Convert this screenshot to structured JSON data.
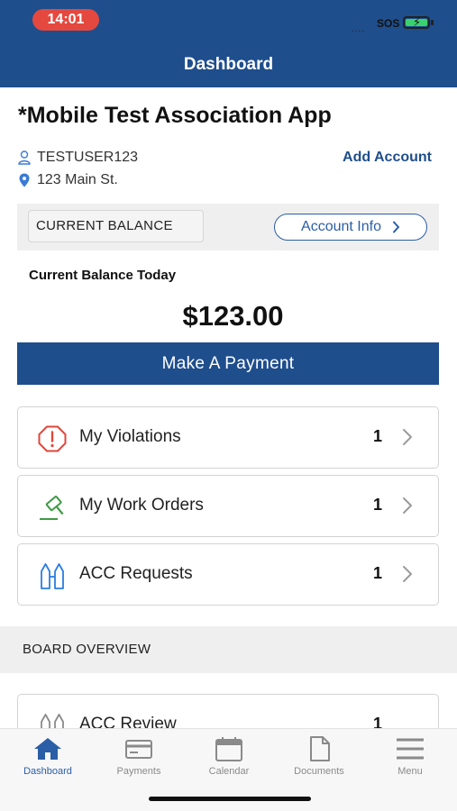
{
  "status_bar": {
    "time": "14:01",
    "signal": "....",
    "sos": "SOS"
  },
  "header": {
    "title": "Dashboard"
  },
  "app": {
    "title": "*Mobile Test Association App",
    "username": "TESTUSER123",
    "address": "123 Main St.",
    "add_account_label": "Add Account"
  },
  "balance": {
    "tab_label": "CURRENT BALANCE",
    "account_info_label": "Account Info",
    "today_label": "Current Balance Today",
    "amount": "$123.00",
    "pay_label": "Make A Payment"
  },
  "items": [
    {
      "label": "My Violations",
      "count": "1",
      "icon": "alert-octagon-icon",
      "color": "#e0453a"
    },
    {
      "label": "My Work Orders",
      "count": "1",
      "icon": "gavel-icon",
      "color": "#3f9b44"
    },
    {
      "label": "ACC Requests",
      "count": "1",
      "icon": "acc-icon",
      "color": "#2a7de1"
    }
  ],
  "board": {
    "section_label": "BOARD OVERVIEW",
    "items": [
      {
        "label": "ACC Review",
        "count": "1"
      }
    ]
  },
  "tabs": [
    {
      "label": "Dashboard",
      "icon": "home-icon",
      "active": true
    },
    {
      "label": "Payments",
      "icon": "card-icon",
      "active": false
    },
    {
      "label": "Calendar",
      "icon": "calendar-icon",
      "active": false
    },
    {
      "label": "Documents",
      "icon": "document-icon",
      "active": false
    },
    {
      "label": "Menu",
      "icon": "menu-icon",
      "active": false
    }
  ],
  "colors": {
    "brand": "#1f4e8c",
    "accent": "#2a5ea7",
    "status_pill": "#e5483e",
    "battery": "#3bd16f"
  }
}
